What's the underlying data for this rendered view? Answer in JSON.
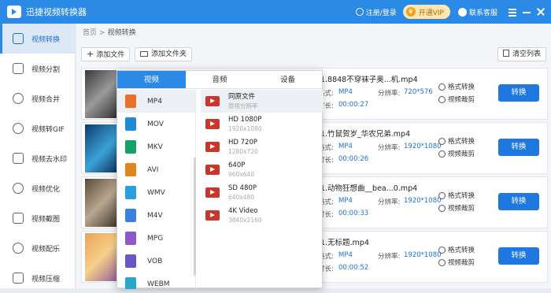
{
  "titlebar": {
    "app_title": "迅捷视频转换器",
    "login": "注册/登录",
    "vip": "开通VIP",
    "service": "联系客服"
  },
  "sidebar": {
    "items": [
      {
        "label": "视频转换",
        "icon": "video-convert-icon",
        "active": true
      },
      {
        "label": "视频分割",
        "icon": "split-icon"
      },
      {
        "label": "视频合并",
        "icon": "merge-icon"
      },
      {
        "label": "视频转GIF",
        "icon": "gif-icon"
      },
      {
        "label": "视频去水印",
        "icon": "watermark-icon"
      },
      {
        "label": "视频优化",
        "icon": "optimize-icon"
      },
      {
        "label": "视频截图",
        "icon": "screenshot-icon"
      },
      {
        "label": "视频配乐",
        "icon": "music-icon"
      },
      {
        "label": "视频压缩",
        "icon": "compress-icon"
      }
    ]
  },
  "breadcrumb": {
    "home": "首页",
    "sep": ">",
    "current": "视频转换"
  },
  "toolbar": {
    "add_file": "添加文件",
    "add_folder": "添加文件夹",
    "clear_list": "清空列表"
  },
  "files": [
    {
      "name": "1.8848不穿袜子奥...机.mp4",
      "format_label": "格式:",
      "format": "MP4",
      "res_label": "分辨率:",
      "resolution": "720*576",
      "dur_label": "时长:",
      "duration": "00:00:27",
      "op1": "格式转换",
      "op2": "视频裁剪",
      "convert": "转换"
    },
    {
      "name": "1.竹鼠贺岁_华农兄弟.mp4",
      "format_label": "格式:",
      "format": "MP4",
      "res_label": "分辨率:",
      "resolution": "1920*1080",
      "dur_label": "时长:",
      "duration": "00:00:26",
      "op1": "格式转换",
      "op2": "视频裁剪",
      "convert": "转换"
    },
    {
      "name": "1.动物狂想曲__bea...0.mp4",
      "format_label": "格式:",
      "format": "MP4",
      "res_label": "分辨率:",
      "resolution": "1920*1080",
      "dur_label": "时长:",
      "duration": "00:00:33",
      "op1": "格式转换",
      "op2": "视频裁剪",
      "convert": "转换"
    },
    {
      "name": "1.无标题.mp4",
      "format_label": "格式:",
      "format": "MP4",
      "res_label": "分辨率:",
      "resolution": "1920*1080",
      "dur_label": "时长:",
      "duration": "00:00:52",
      "op1": "格式转换",
      "op2": "视频裁剪",
      "convert": "转换"
    }
  ],
  "popup": {
    "tabs": [
      "视频",
      "音频",
      "设备"
    ],
    "formats": [
      {
        "label": "MP4",
        "color": "#e8722a",
        "active": true
      },
      {
        "label": "MOV",
        "color": "#1f8bd6"
      },
      {
        "label": "MKV",
        "color": "#16a06a"
      },
      {
        "label": "AVI",
        "color": "#e0861c"
      },
      {
        "label": "WMV",
        "color": "#2aa0e0"
      },
      {
        "label": "M4V",
        "color": "#3b82e0"
      },
      {
        "label": "MPG",
        "color": "#8e58c8"
      },
      {
        "label": "VOB",
        "color": "#6a56c8"
      },
      {
        "label": "WEBM",
        "color": "#27a7c9"
      }
    ],
    "resolutions": [
      {
        "title": "同原文件",
        "sub": "原视分辨率",
        "active": true
      },
      {
        "title": "HD 1080P",
        "sub": "1920x1080"
      },
      {
        "title": "HD 720P",
        "sub": "1280x720"
      },
      {
        "title": "640P",
        "sub": "960x640"
      },
      {
        "title": "SD 480P",
        "sub": "640x480"
      },
      {
        "title": "4K Video",
        "sub": "3840x2160"
      }
    ]
  }
}
